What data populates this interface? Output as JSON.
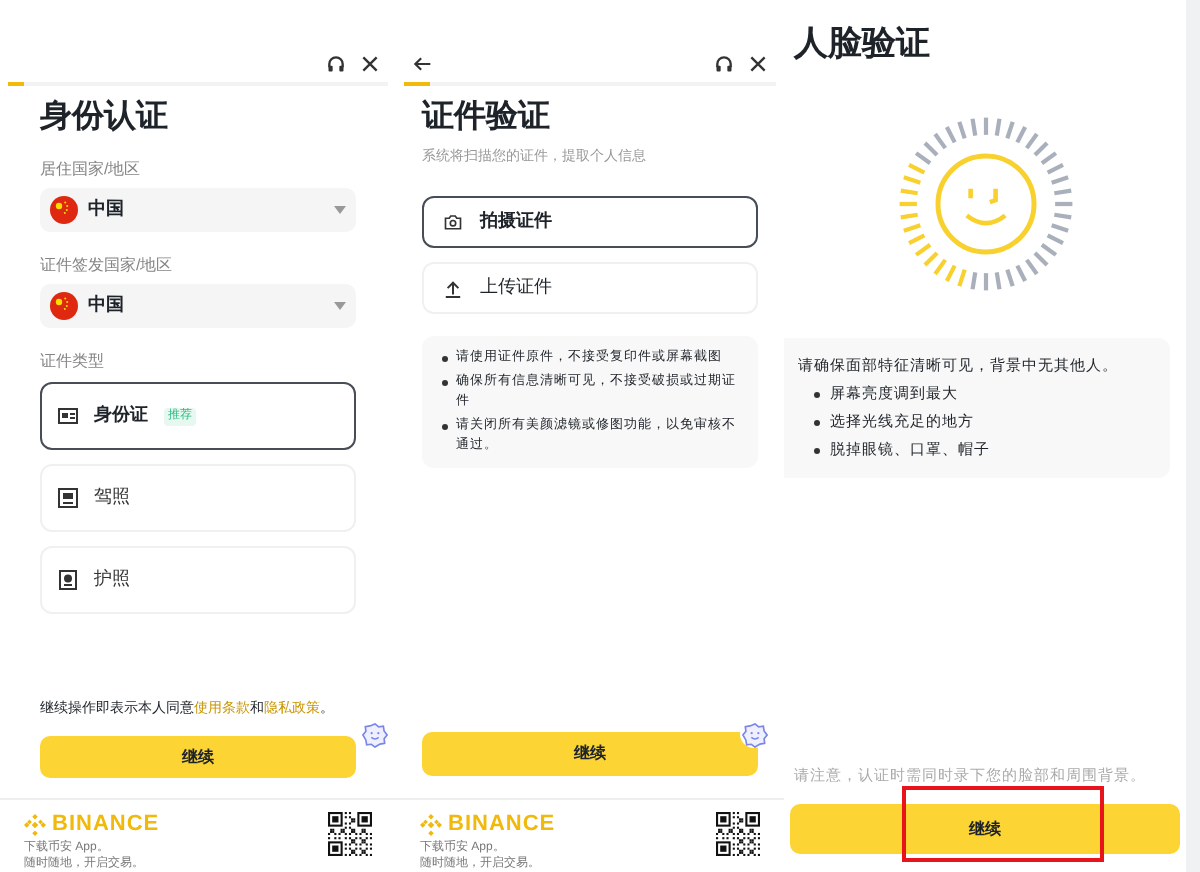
{
  "identity_screen": {
    "progress": {
      "level": 0.04
    },
    "title": "身份认证",
    "residence": {
      "label": "居住国家/地区",
      "value": "中国"
    },
    "issuer": {
      "label": "证件签发国家/地区",
      "value": "中国"
    },
    "doc_type_label": "证件类型",
    "doc_types": [
      {
        "label": "身份证",
        "badge": "推荐",
        "selected": true
      },
      {
        "label": "驾照",
        "selected": false
      },
      {
        "label": "护照",
        "selected": false
      }
    ],
    "terms": "继续操作即表示本人同意",
    "terms_link_1": "使用条款",
    "terms_and": "和",
    "terms_link_2": "隐私政策",
    "terms_end": "。",
    "continue_button": "继续",
    "footer": {
      "brand": "BINANCE",
      "line_1": "下载币安 App。",
      "line_2": "随时随地，开启交易。"
    }
  },
  "document_screen": {
    "progress": {
      "level": 0.07
    },
    "title": "证件验证",
    "subtitle": "系统将扫描您的证件，提取个人信息",
    "options": [
      {
        "kind": "camera",
        "label": "拍摄证件",
        "selected": true
      },
      {
        "kind": "upload",
        "label": "上传证件",
        "selected": false
      }
    ],
    "tips": [
      "请使用证件原件，不接受复印件或屏幕截图",
      "确保所有信息清晰可见，不接受破损或过期证件",
      "请关闭所有美颜滤镜或修图功能，以免审核不通过。"
    ],
    "continue_button": "继续",
    "footer": {
      "brand": "BINANCE",
      "line_1": "下载币安 App。",
      "line_2": "随时随地，开启交易。"
    }
  },
  "face_screen": {
    "title": "人脸验证",
    "intro": "请确保面部特征清晰可见，背景中无其他人。",
    "tips": [
      "屏幕亮度调到最大",
      "选择光线充足的地方",
      "脱掉眼镜、口罩、帽子"
    ],
    "note": "请注意，认证时需同时录下您的脸部和周围背景。",
    "continue_button": "继续",
    "highlighted": true
  }
}
